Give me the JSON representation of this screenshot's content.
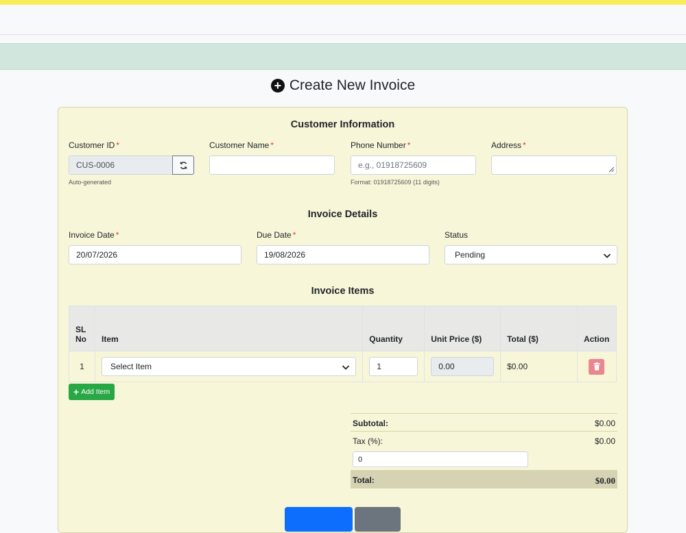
{
  "page": {
    "title": "Create New Invoice"
  },
  "customer": {
    "section_title": "Customer Information",
    "id_label": "Customer ID",
    "id_value": "CUS-0006",
    "id_help": "Auto-generated",
    "name_label": "Customer Name",
    "name_value": "",
    "phone_label": "Phone Number",
    "phone_placeholder": "e.g., 01918725609",
    "phone_help": "Format: 01918725609 (11 digits)",
    "address_label": "Address",
    "address_value": ""
  },
  "invoice": {
    "section_title": "Invoice Details",
    "date_label": "Invoice Date",
    "date_value": "20/07/2026",
    "due_label": "Due Date",
    "due_value": "19/08/2026",
    "status_label": "Status",
    "status_value": "Pending"
  },
  "items": {
    "section_title": "Invoice Items",
    "columns": {
      "sl_top": "SL",
      "sl_bottom": "No",
      "item": "Item",
      "quantity": "Quantity",
      "unit_price": "Unit Price ($)",
      "total": "Total ($)",
      "action": "Action"
    },
    "rows": [
      {
        "sl": "1",
        "item": "Select Item",
        "quantity": "1",
        "unit_price": "0.00",
        "total": "$0.00"
      }
    ],
    "add_label": "Add Item"
  },
  "totals": {
    "subtotal_label": "Subtotal:",
    "subtotal_value": "$0.00",
    "tax_label": "Tax (%):",
    "tax_amount": "$0.00",
    "tax_input": "0",
    "total_label": "Total:",
    "total_value": "$0.00"
  },
  "colors": {
    "card": "#f8f6d9",
    "add_button": "#28a745",
    "delete_button": "#ea868f",
    "alert": "#d1e7dd",
    "stripe": "#f8ec5b",
    "primary_button": "#0d6efd",
    "secondary_button": "#6c757d"
  }
}
